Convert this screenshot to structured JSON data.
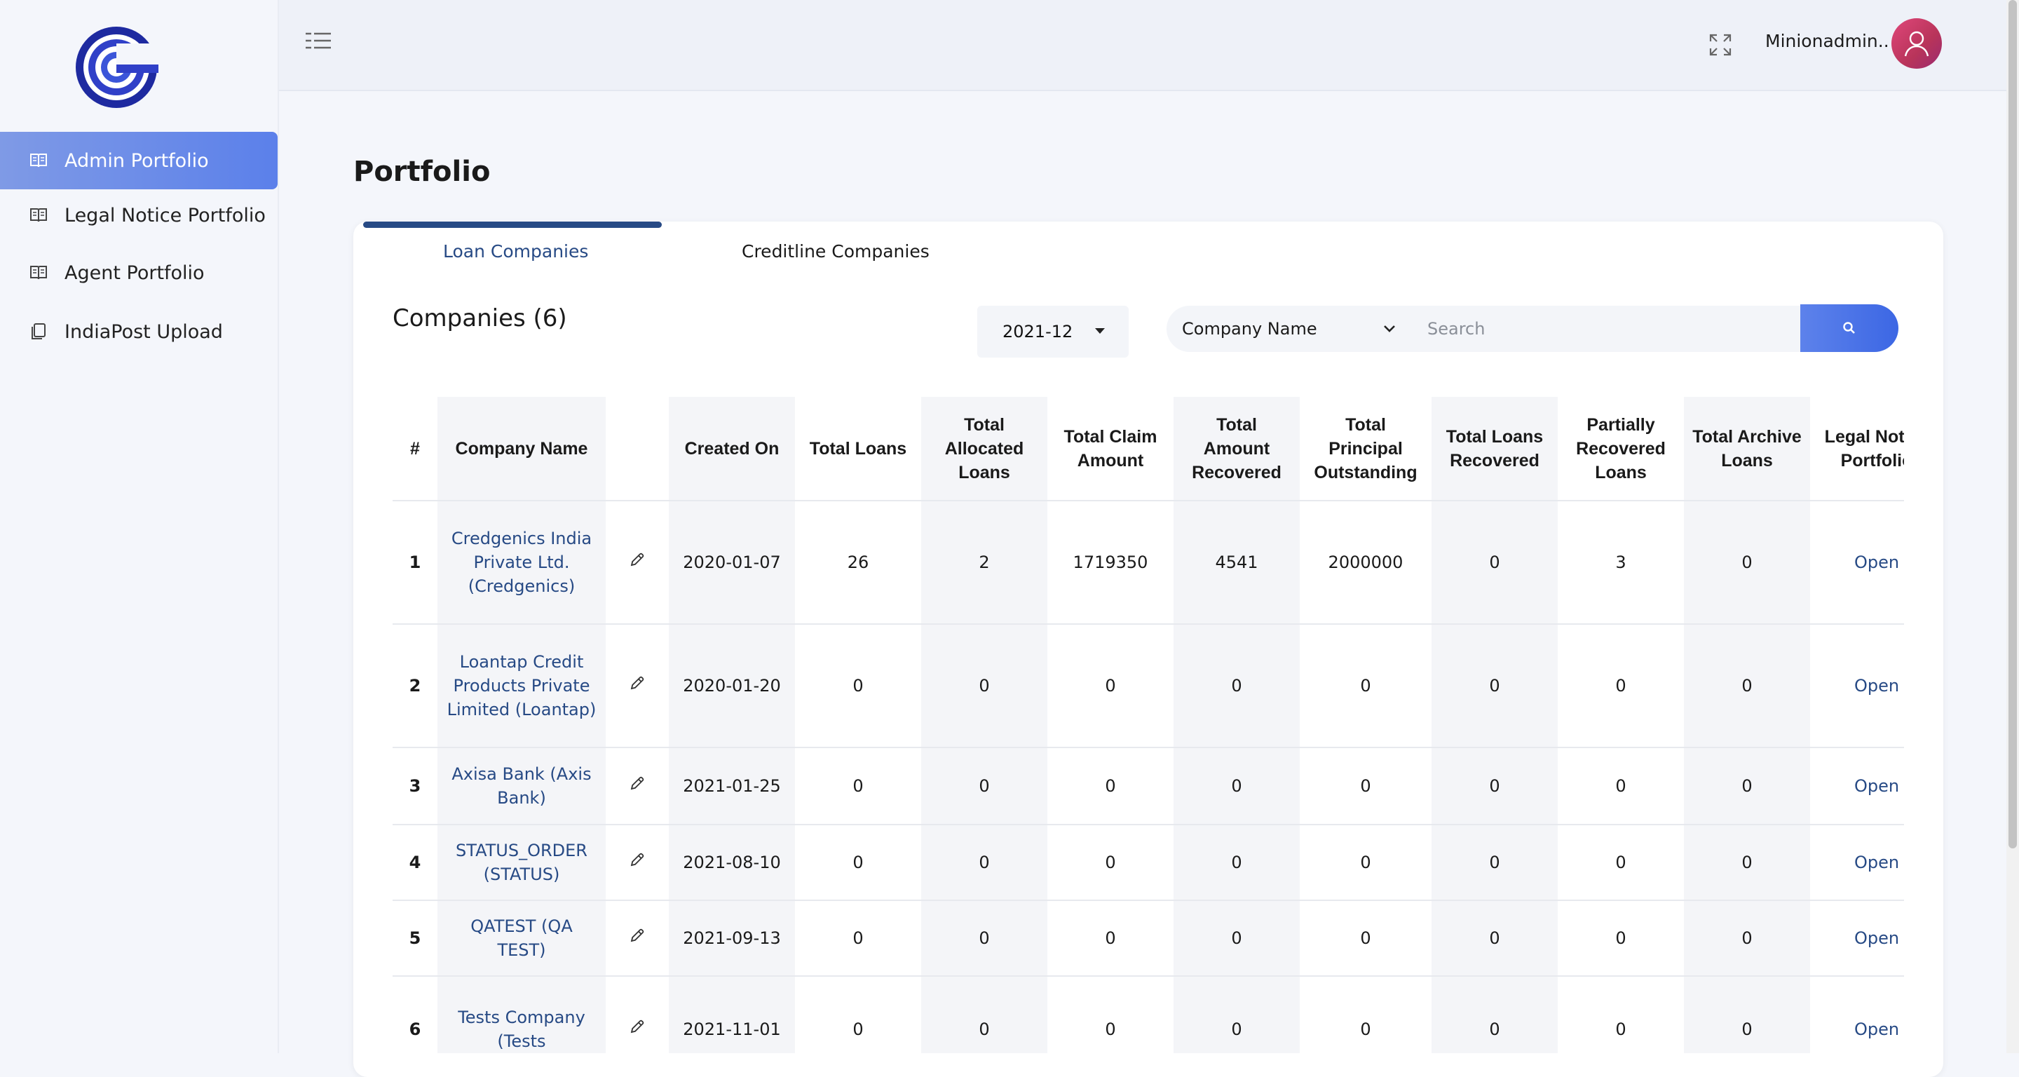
{
  "sidebar": {
    "items": [
      {
        "label": "Admin Portfolio",
        "icon": "book-icon",
        "active": true
      },
      {
        "label": "Legal Notice Portfolio",
        "icon": "book-icon",
        "active": false
      },
      {
        "label": "Agent Portfolio",
        "icon": "book-icon",
        "active": false
      },
      {
        "label": "IndiaPost Upload",
        "icon": "copy-icon",
        "active": false
      }
    ]
  },
  "header": {
    "username": "Minionadmin..",
    "icons": [
      "menu-toggle-icon",
      "fullscreen-icon",
      "user-avatar-icon"
    ]
  },
  "page": {
    "title": "Portfolio",
    "tabs": [
      {
        "label": "Loan Companies",
        "active": true
      },
      {
        "label": "Creditline Companies",
        "active": false
      }
    ]
  },
  "filters": {
    "companies_title": "Companies (6)",
    "month": "2021-12",
    "field": "Company Name",
    "search_placeholder": "Search"
  },
  "table": {
    "headers": [
      "#",
      "Company Name",
      "",
      "Created On",
      "Total Loans",
      "Total Allocated Loans",
      "Total Claim Amount",
      "Total Amount Recovered",
      "Total Principal Outstanding",
      "Total Loans Recovered",
      "Partially Recovered Loans",
      "Total Archive Loans",
      "Legal Notice Portfolio"
    ],
    "rows": [
      {
        "idx": "1",
        "name": "Credgenics India Private Ltd. (Credgenics)",
        "created": "2020-01-07",
        "total_loans": "26",
        "allocated": "2",
        "claim": "1719350",
        "recovered_amt": "4541",
        "principal": "2000000",
        "loans_recovered": "0",
        "partial": "3",
        "archive": "0",
        "legal": "Open"
      },
      {
        "idx": "2",
        "name": "Loantap Credit Products Private Limited (Loantap)",
        "created": "2020-01-20",
        "total_loans": "0",
        "allocated": "0",
        "claim": "0",
        "recovered_amt": "0",
        "principal": "0",
        "loans_recovered": "0",
        "partial": "0",
        "archive": "0",
        "legal": "Open"
      },
      {
        "idx": "3",
        "name": "Axisa Bank (Axis Bank)",
        "created": "2021-01-25",
        "total_loans": "0",
        "allocated": "0",
        "claim": "0",
        "recovered_amt": "0",
        "principal": "0",
        "loans_recovered": "0",
        "partial": "0",
        "archive": "0",
        "legal": "Open"
      },
      {
        "idx": "4",
        "name": "STATUS_ORDER (STATUS)",
        "created": "2021-08-10",
        "total_loans": "0",
        "allocated": "0",
        "claim": "0",
        "recovered_amt": "0",
        "principal": "0",
        "loans_recovered": "0",
        "partial": "0",
        "archive": "0",
        "legal": "Open"
      },
      {
        "idx": "5",
        "name": "QATEST (QA TEST)",
        "created": "2021-09-13",
        "total_loans": "0",
        "allocated": "0",
        "claim": "0",
        "recovered_amt": "0",
        "principal": "0",
        "loans_recovered": "0",
        "partial": "0",
        "archive": "0",
        "legal": "Open"
      },
      {
        "idx": "6",
        "name": "Tests Company (Tests",
        "created": "2021-11-01",
        "total_loans": "0",
        "allocated": "0",
        "claim": "0",
        "recovered_amt": "0",
        "principal": "0",
        "loans_recovered": "0",
        "partial": "0",
        "archive": "0",
        "legal": "Open"
      }
    ]
  },
  "colors": {
    "accent": "#5b80ea",
    "link": "#274a85",
    "avatar": "#c93a66"
  }
}
